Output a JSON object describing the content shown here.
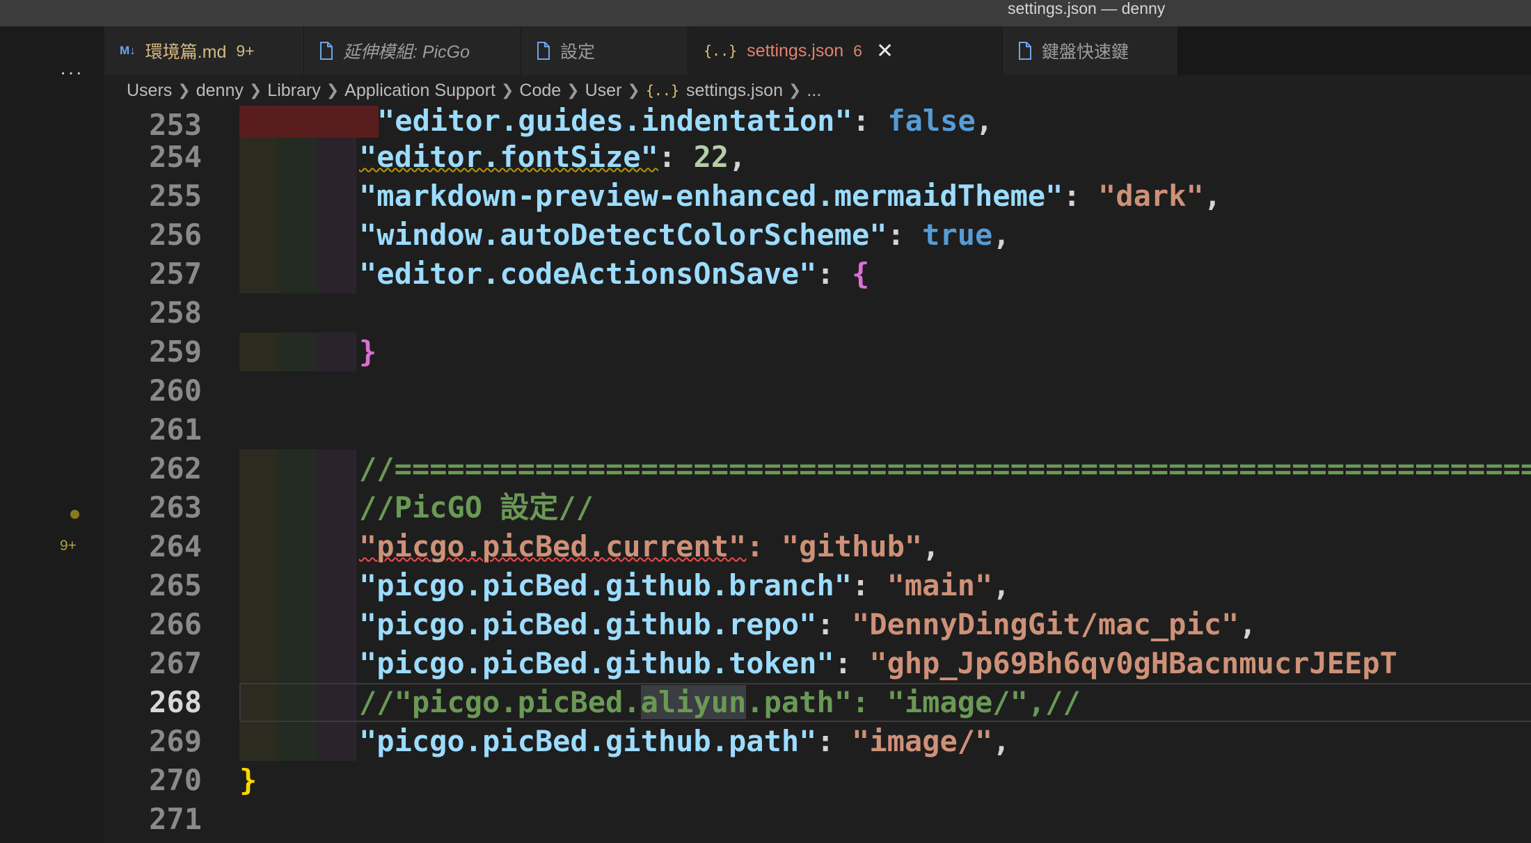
{
  "window": {
    "title": "settings.json — denny"
  },
  "sidebar": {
    "more_label": "···",
    "scm_badge": "9+"
  },
  "tabs": [
    {
      "icon": "M↓",
      "label": "環境篇.md",
      "badge": "9+"
    },
    {
      "label": "延伸模組: PicGo"
    },
    {
      "label": "設定"
    },
    {
      "icon": "{..}",
      "label": "settings.json",
      "badge": "6",
      "close": "✕"
    },
    {
      "label": "鍵盤快速鍵"
    }
  ],
  "breadcrumb": {
    "items": [
      "Users",
      "denny",
      "Library",
      "Application Support",
      "Code",
      "User",
      "settings.json",
      "..."
    ],
    "json_icon": "{..}"
  },
  "editor": {
    "current_line": 268,
    "line_numbers": [
      "253",
      "254",
      "255",
      "256",
      "257",
      "258",
      "259",
      "260",
      "261",
      "262",
      "263",
      "264",
      "265",
      "266",
      "267",
      "268",
      "269",
      "270",
      "271"
    ],
    "tokens": {
      "l253_key": "\"editor.guides.indentation\"",
      "l253_colon": ": ",
      "l253_val": "false",
      "l253_end": ",",
      "l254_key": "\"editor.fontSize\"",
      "l254_colon": ": ",
      "l254_val": "22",
      "l254_end": ",",
      "l255_key": "\"markdown-preview-enhanced.mermaidTheme\"",
      "l255_colon": ": ",
      "l255_val": "\"dark\"",
      "l255_end": ",",
      "l256_key": "\"window.autoDetectColorScheme\"",
      "l256_colon": ": ",
      "l256_val": "true",
      "l256_end": ",",
      "l257_key": "\"editor.codeActionsOnSave\"",
      "l257_colon": ": ",
      "l257_val": "{",
      "l259_val": "}",
      "l262_comment": "//===================================================================",
      "l263_comment": "//PicGO 設定//",
      "l264_key": "\"picgo.picBed.current\"",
      "l264_colon": ": ",
      "l264_val": "\"github\"",
      "l264_end": ",",
      "l265_key": "\"picgo.picBed.github.branch\"",
      "l265_colon": ": ",
      "l265_val": "\"main\"",
      "l265_end": ",",
      "l266_key": "\"picgo.picBed.github.repo\"",
      "l266_colon": ": ",
      "l266_val": "\"DennyDingGit/mac_pic\"",
      "l266_end": ",",
      "l267_key": "\"picgo.picBed.github.token\"",
      "l267_colon": ": ",
      "l267_val": "\"ghp_Jp69Bh6qv0gHBacnmucrJEEpT",
      "l268_a": "//\"picgo.picBed.",
      "l268_b": "aliyun",
      "l268_c": ".path\": \"image/\",//",
      "l269_key": "\"picgo.picBed.github.path\"",
      "l269_colon": ": ",
      "l269_val": "\"image/\"",
      "l269_end": ",",
      "l270_val": "}"
    }
  },
  "colors": {
    "key": "#9cdcfe",
    "string": "#ce9178",
    "number": "#b5cea8",
    "boolean": "#569cd6",
    "comment": "#6a9955",
    "active_tab_text": "#e2826f"
  }
}
